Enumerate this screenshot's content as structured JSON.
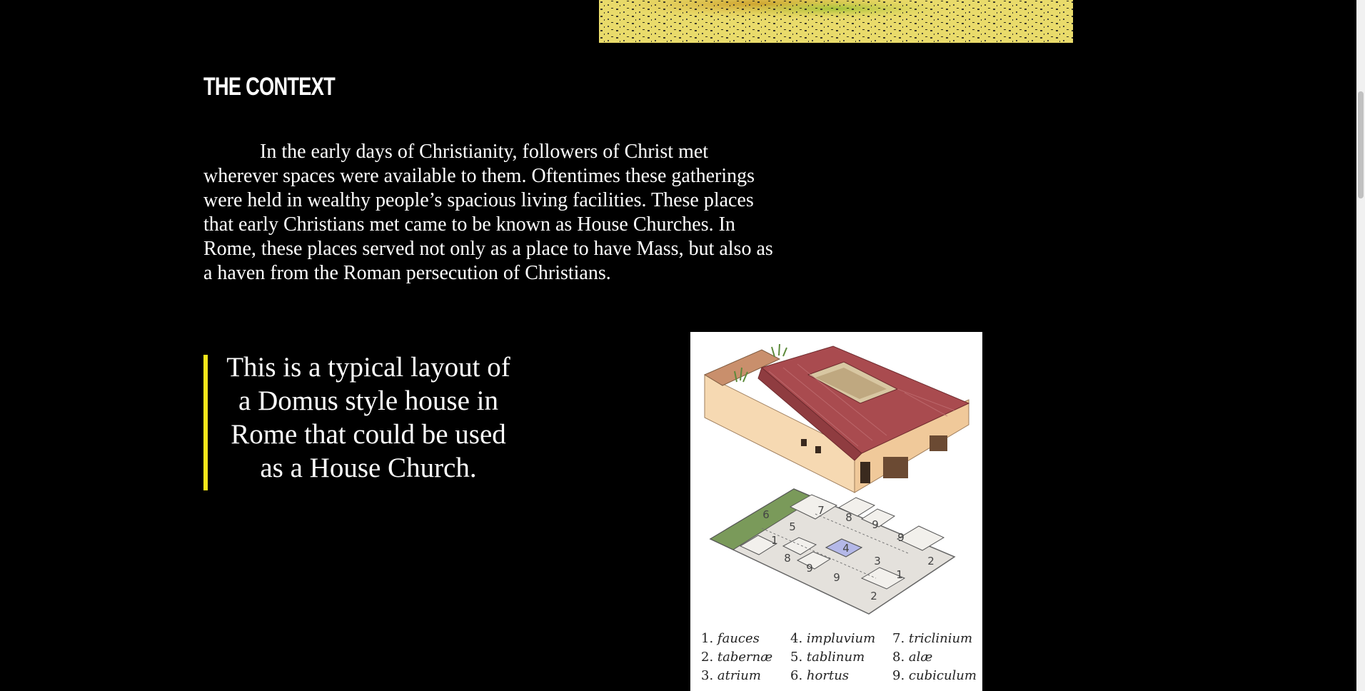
{
  "section": {
    "heading": "THE CONTEXT",
    "paragraph": "In the early days of Christianity, followers of Christ met wherever spaces were available to them. Oftentimes these gatherings were held in wealthy people’s spacious living facilities. These places that early Christians met came to be known as House Churches. In Rome, these places served not only as a place to have Mass, but also as a haven from the Roman persecution of Christians."
  },
  "quote": {
    "text": "This is a typical layout of a Domus style house in Rome that could be used as a House Church.",
    "accent_color": "#f5e61a"
  },
  "figure": {
    "plan_numbers": [
      "6",
      "7",
      "8",
      "9",
      "9",
      "5",
      "1",
      "4",
      "3",
      "2",
      "8",
      "9",
      "9",
      "1",
      "2"
    ],
    "legend": [
      {
        "num": "1.",
        "term": "fauces"
      },
      {
        "num": "4.",
        "term": "impluvium"
      },
      {
        "num": "7.",
        "term": "triclinium"
      },
      {
        "num": "2.",
        "term": "tabernæ"
      },
      {
        "num": "5.",
        "term": "tablinum"
      },
      {
        "num": "8.",
        "term": "alæ"
      },
      {
        "num": "3.",
        "term": "atrium"
      },
      {
        "num": "6.",
        "term": "hortus"
      },
      {
        "num": "9.",
        "term": "cubiculum"
      }
    ]
  },
  "colors": {
    "background": "#000000",
    "roof": "#a94b4f",
    "walls": "#f3d3a8",
    "garden": "#7a9a5a"
  }
}
